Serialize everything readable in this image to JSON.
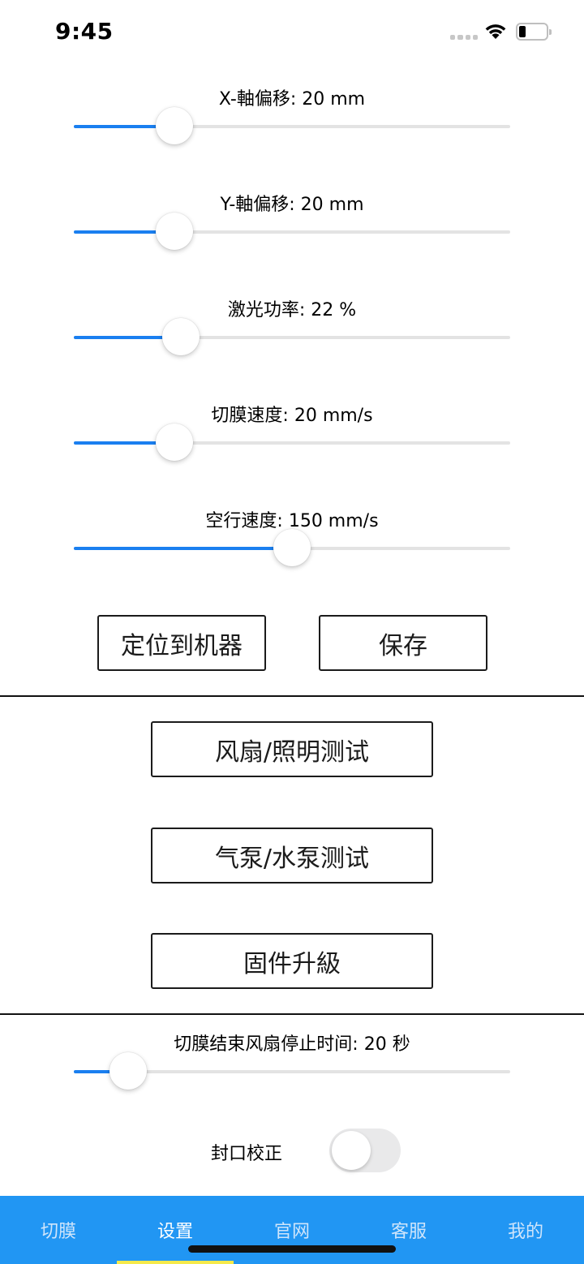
{
  "status_bar": {
    "time": "9:45"
  },
  "sliders": [
    {
      "label": "X-軸偏移: 20 mm",
      "value": 0.23
    },
    {
      "label": "Y-軸偏移: 20 mm",
      "value": 0.23
    },
    {
      "label": "激光功率: 22 %",
      "value": 0.245
    },
    {
      "label": "切膜速度: 20 mm/s",
      "value": 0.23
    },
    {
      "label": "空行速度: 150 mm/s",
      "value": 0.5
    }
  ],
  "buttons": {
    "locate": "定位到机器",
    "save": "保存",
    "fan_light_test": "风扇/照明测试",
    "air_water_pump_test": "气泵/水泵测试",
    "firmware_upgrade": "固件升級"
  },
  "fan_stop": {
    "label": "切膜结束风扇停止时间: 20 秒",
    "value": 0.125
  },
  "seal_correction": {
    "label": "封口校正",
    "enabled": false
  },
  "tabs": [
    {
      "label": "切膜",
      "active": false
    },
    {
      "label": "设置",
      "active": true
    },
    {
      "label": "官网",
      "active": false
    },
    {
      "label": "客服",
      "active": false
    },
    {
      "label": "我的",
      "active": false
    }
  ],
  "colors": {
    "accent": "#1a7ff0",
    "tab_bar": "#2196f3",
    "tab_indicator": "#f5e94a"
  }
}
